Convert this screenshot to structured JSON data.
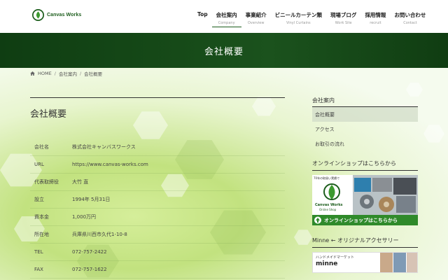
{
  "header": {
    "logo_text": "Canvas Works",
    "logo_small_text": "Canvas Works",
    "nav": [
      {
        "label": "Top",
        "sub": ""
      },
      {
        "label": "会社案内",
        "sub": "Company"
      },
      {
        "label": "事業紹介",
        "sub": "Overview"
      },
      {
        "label": "ビニールカーテン類",
        "sub": "Vinyl Curtains"
      },
      {
        "label": "現場ブログ",
        "sub": "Work Site"
      },
      {
        "label": "採用情報",
        "sub": "recruit"
      },
      {
        "label": "お問い合わせ",
        "sub": "Contact"
      }
    ],
    "active_index": 1
  },
  "page_title": "会社概要",
  "breadcrumb": {
    "home": "HOME",
    "items": [
      "会社案内",
      "会社概要"
    ],
    "separator": "/"
  },
  "main": {
    "title": "会社概要",
    "rows": [
      {
        "label": "会社名",
        "value": "株式会社キャンバスワークス"
      },
      {
        "label": "URL",
        "value": "https://www.canvas-works.com"
      },
      {
        "label": "代表取締役",
        "value": "大竹 直"
      },
      {
        "label": "設立",
        "value": "1994年 5月31日"
      },
      {
        "label": "資本金",
        "value": "1,000万円"
      },
      {
        "label": "所在地",
        "value": "兵庫県川西市久代1-10-8"
      },
      {
        "label": "TEL",
        "value": "072-757-2422"
      },
      {
        "label": "FAX",
        "value": "072-757-1622"
      }
    ]
  },
  "sidebar": {
    "heading": "会社案内",
    "items": [
      "会社概要",
      "アクセス",
      "お取引の流れ"
    ],
    "active_index": 0,
    "shop_heading": "オンラインショップはこちらから",
    "shop_banner": {
      "top_text": "70年の取扱い実績で",
      "brand": "Canvas Works",
      "brand_sub": "Online Shop",
      "cta": "オンラインショップはこちらから"
    },
    "minne_heading": "Minne ← オリジナルアクセサリー",
    "minne_banner": {
      "top_text": "ハンドメイドマーケット",
      "brand": "minne"
    }
  },
  "colors": {
    "brand_green": "#1c5d1c",
    "band_green": "#164a18",
    "cta_green": "#2f8a2a"
  }
}
